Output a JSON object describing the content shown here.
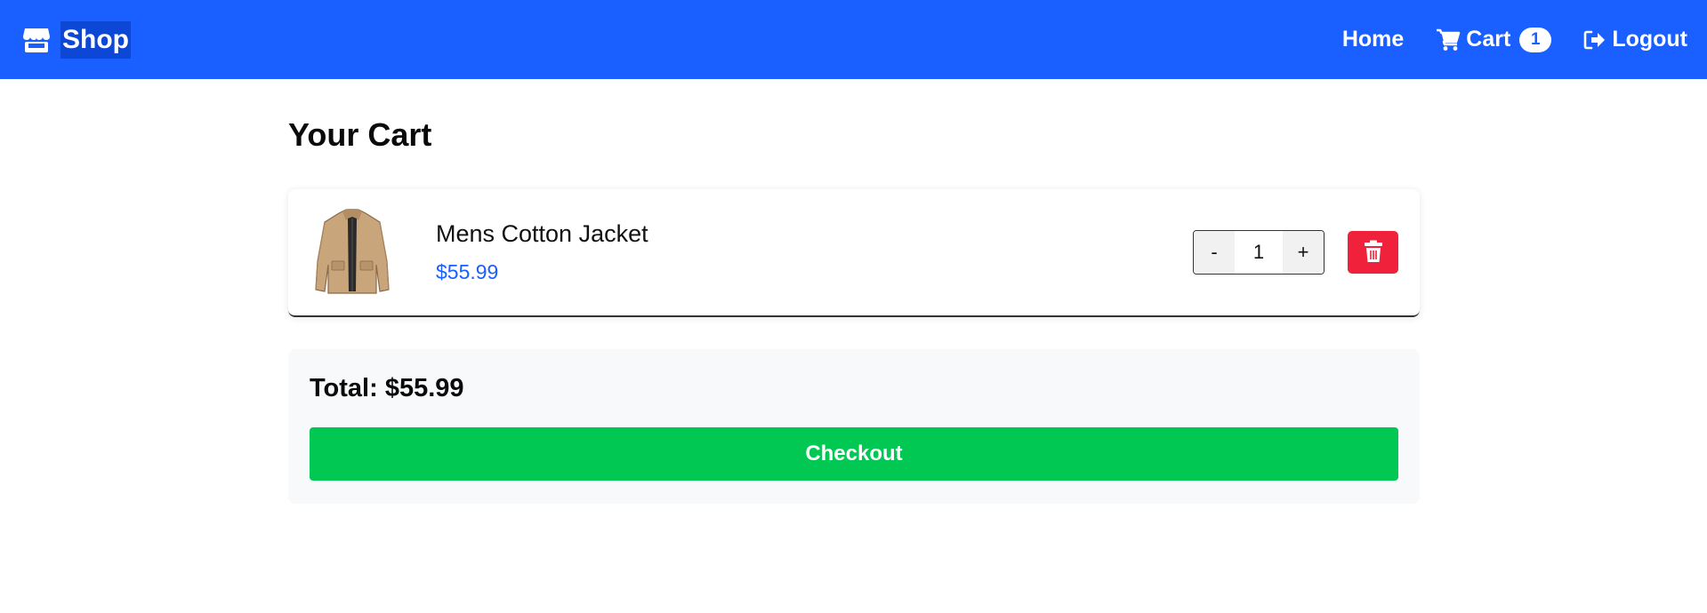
{
  "navbar": {
    "brand": {
      "icon": "store-icon",
      "label": "Shop"
    },
    "links": {
      "home": {
        "label": "Home"
      },
      "cart": {
        "icon": "cart-icon",
        "label": "Cart",
        "count": "1"
      },
      "logout": {
        "icon": "logout-icon",
        "label": "Logout"
      }
    },
    "colors": {
      "background": "#1a5fff",
      "badge_text": "#1a5fff"
    }
  },
  "main": {
    "title": "Your Cart",
    "items": [
      {
        "image_icon": "jacket-image",
        "name": "Mens Cotton Jacket",
        "price": "$55.99",
        "quantity": "1",
        "decrement_label": "-",
        "increment_label": "+",
        "delete_icon": "trash-icon"
      }
    ],
    "summary": {
      "total_label": "Total: $55.99",
      "checkout_label": "Checkout"
    }
  },
  "colors": {
    "price": "#1a5fff",
    "delete": "#f0223b",
    "checkout": "#00c853",
    "summary_bg": "#f8f9fa"
  }
}
